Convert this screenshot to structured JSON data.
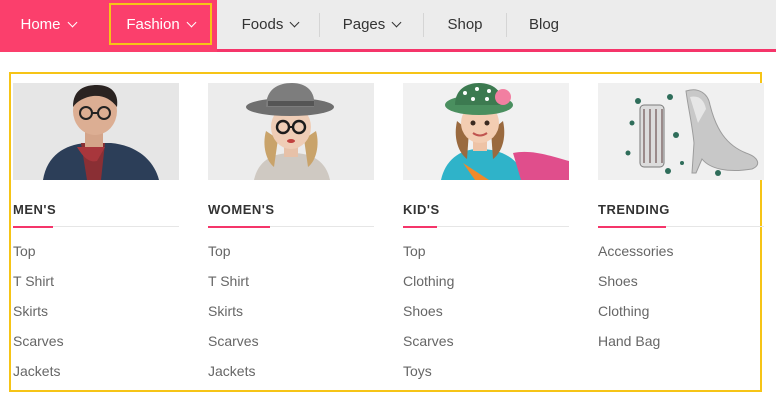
{
  "nav": {
    "items": [
      {
        "label": "Home"
      },
      {
        "label": "Fashion"
      },
      {
        "label": "Foods"
      },
      {
        "label": "Pages"
      },
      {
        "label": "Shop"
      },
      {
        "label": "Blog"
      }
    ]
  },
  "menu": {
    "columns": [
      {
        "title": "MEN'S",
        "image": "man-wearing-glasses-photo",
        "links": [
          "Top",
          "T Shirt",
          "Skirts",
          "Scarves",
          "Jackets"
        ]
      },
      {
        "title": "WOMEN'S",
        "image": "woman-wearing-hat-photo",
        "links": [
          "Top",
          "T Shirt",
          "Skirts",
          "Scarves",
          "Jackets"
        ]
      },
      {
        "title": "KID'S",
        "image": "girl-wearing-hat-photo",
        "links": [
          "Top",
          "Clothing",
          "Shoes",
          "Scarves",
          "Toys"
        ]
      },
      {
        "title": "TRENDING",
        "image": "high-heel-shoe-photo",
        "links": [
          "Accessories",
          "Shoes",
          "Clothing",
          "Hand Bag"
        ]
      }
    ]
  },
  "colors": {
    "accent": "#fb3f6c",
    "highlight": "#f6c416",
    "nav_bg": "#ececec"
  }
}
